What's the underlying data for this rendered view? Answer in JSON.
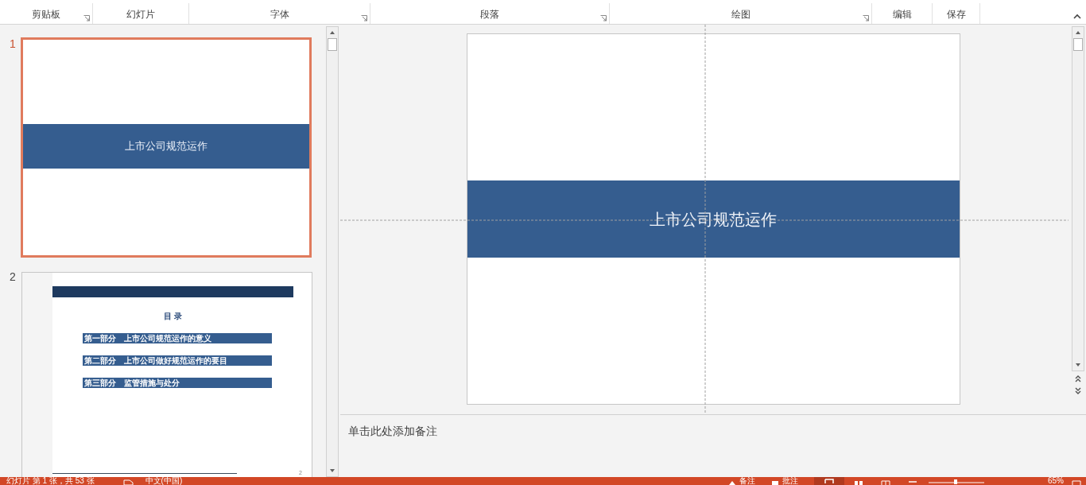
{
  "ribbon": {
    "groups": [
      {
        "label": "剪贴板",
        "launcher": true
      },
      {
        "label": "幻灯片",
        "launcher": false
      },
      {
        "label": "字体",
        "launcher": true
      },
      {
        "label": "段落",
        "launcher": true
      },
      {
        "label": "绘图",
        "launcher": true
      },
      {
        "label": "编辑",
        "launcher": false
      },
      {
        "label": "保存",
        "launcher": false
      }
    ]
  },
  "slides_panel": {
    "thumbnails": [
      {
        "number": "1",
        "selected": true,
        "kind": "title",
        "title": "上市公司规范运作"
      },
      {
        "number": "2",
        "selected": false,
        "kind": "contents",
        "heading": "目 录",
        "items": [
          "第一部分　上市公司规范运作的意义",
          "第二部分　上市公司做好规范运作的要目",
          "第三部分　监管措施与处分"
        ],
        "page_number": "2"
      }
    ]
  },
  "slide": {
    "title": "上市公司规范运作"
  },
  "notes": {
    "placeholder": "单击此处添加备注"
  },
  "status_bar": {
    "slide_info": "幻灯片 第 1 张，共 53 张",
    "language": "中文(中国)",
    "notes": "备注",
    "comments": "批注",
    "zoom": "65%"
  }
}
